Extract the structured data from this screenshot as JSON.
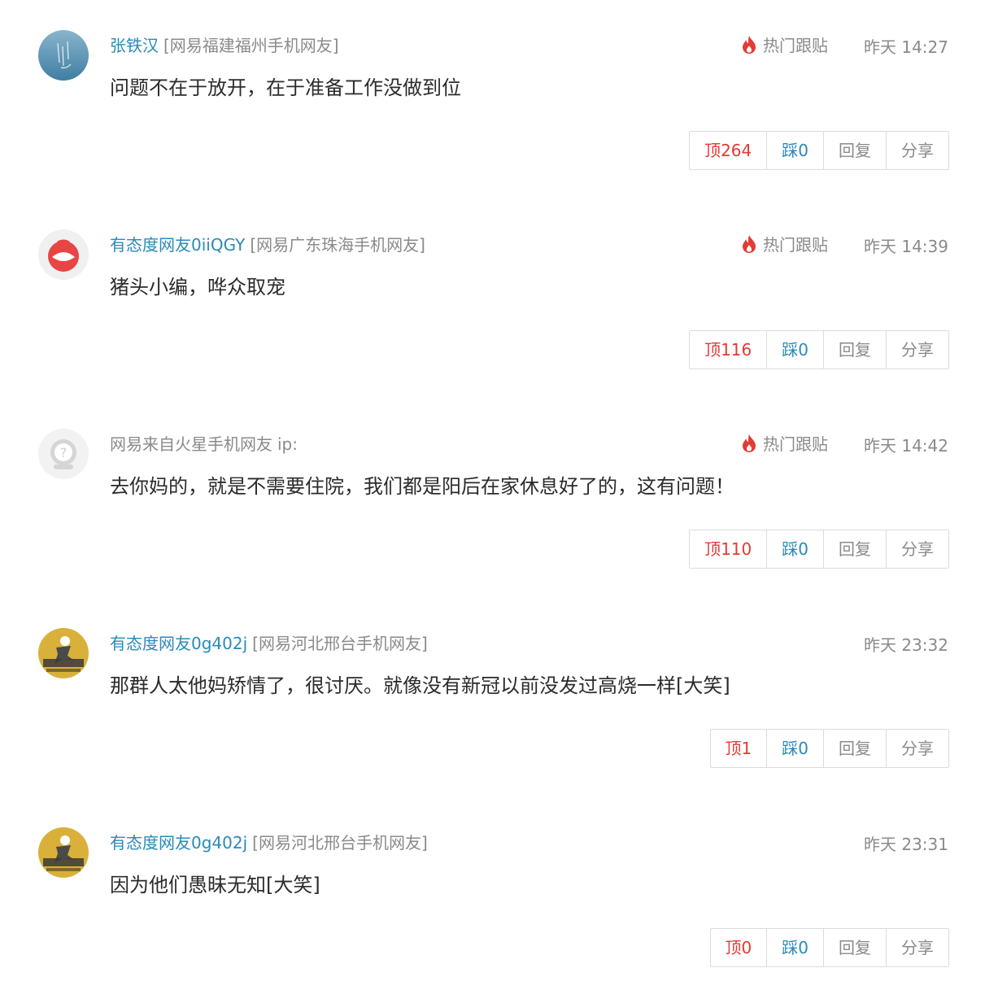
{
  "hot_label": "热门跟贴",
  "comments": [
    {
      "user": "张铁汉",
      "location": "[网易福建福州手机网友]",
      "hot": true,
      "time": "昨天 14:27",
      "content": "问题不在于放开，在于准备工作没做到位",
      "up": "顶264",
      "down": "踩0",
      "reply": "回复",
      "share": "分享"
    },
    {
      "user": "有态度网友0iiQGY",
      "location": "[网易广东珠海手机网友]",
      "hot": true,
      "time": "昨天 14:39",
      "content": "猪头小编，哗众取宠",
      "up": "顶116",
      "down": "踩0",
      "reply": "回复",
      "share": "分享"
    },
    {
      "user": "网易来自火星手机网友",
      "location": "ip:",
      "hot": true,
      "time": "昨天 14:42",
      "content": "去你妈的，就是不需要住院，我们都是阳后在家休息好了的，这有问题！",
      "up": "顶110",
      "down": "踩0",
      "reply": "回复",
      "share": "分享"
    },
    {
      "user": "有态度网友0g402j",
      "location": "[网易河北邢台手机网友]",
      "hot": false,
      "time": "昨天 23:32",
      "content": "那群人太他妈矫情了，很讨厌。就像没有新冠以前没发过高烧一样[大笑]",
      "up": "顶1",
      "down": "踩0",
      "reply": "回复",
      "share": "分享"
    },
    {
      "user": "有态度网友0g402j",
      "location": "[网易河北邢台手机网友]",
      "hot": false,
      "time": "昨天 23:31",
      "content": "因为他们愚昧无知[大笑]",
      "up": "顶0",
      "down": "踩0",
      "reply": "回复",
      "share": "分享"
    }
  ]
}
